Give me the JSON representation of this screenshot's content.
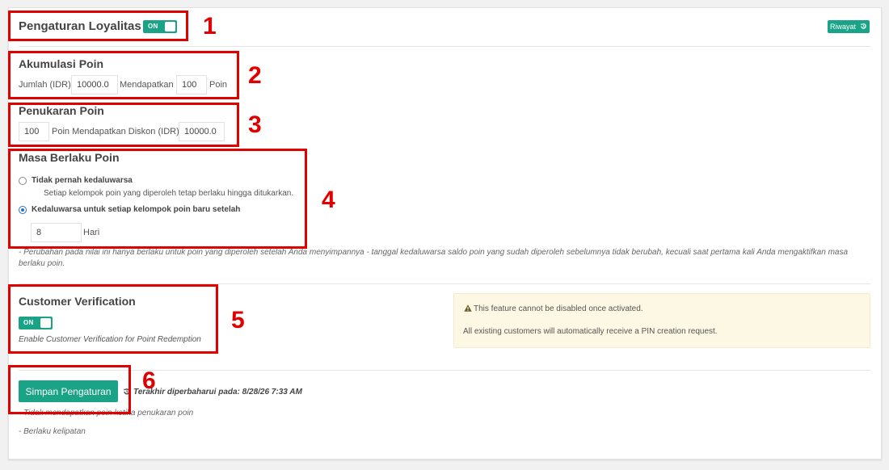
{
  "header": {
    "title": "Pengaturan Loyalitas",
    "toggle_label": "ON",
    "history_button": "Riwayat"
  },
  "accumulation": {
    "title": "Akumulasi Poin",
    "amount_label": "Jumlah (IDR)",
    "amount_value": "10000.0",
    "earn_label": "Mendapatkan",
    "points_value": "100",
    "points_label": "Poin"
  },
  "redemption": {
    "title": "Penukaran Poin",
    "points_value": "100",
    "discount_label": "Poin Mendapatkan Diskon (IDR)",
    "discount_value": "10000.0"
  },
  "validity": {
    "title": "Masa Berlaku Poin",
    "option1_label": "Tidak pernah kedaluwarsa",
    "option1_desc": "Setiap kelompok poin yang diperoleh tetap berlaku hingga ditukarkan.",
    "option2_label": "Kedaluwarsa untuk setiap kelompok poin baru setelah",
    "days_value": "8",
    "days_label": "Hari",
    "note_line1": "- Perubahan pada nilai ini hanya berlaku untuk poin yang diperoleh setelah Anda menyimpannya - tanggal kedaluwarsa saldo poin yang sudah diperoleh sebelumnya tidak berubah, kecuali saat pertama kali Anda mengaktifkan masa",
    "note_line2": "berlaku poin."
  },
  "verification": {
    "title": "Customer Verification",
    "toggle_label": "ON",
    "desc": "Enable Customer Verification for Point Redemption",
    "warning_line1": "This feature cannot be disabled once activated.",
    "warning_line2": "All existing customers will automatically receive a PIN creation request."
  },
  "footer": {
    "save_button": "Simpan Pengaturan",
    "last_updated": "Terakhir diperbaharui pada: 8/28/26 7:33 AM",
    "note1": "- Tidak mendapatkan poin ketika penukaran poin",
    "note2": "- Berlaku kelipatan"
  },
  "annotations": [
    "1",
    "2",
    "3",
    "4",
    "5",
    "6"
  ],
  "colors": {
    "accent": "#1aa387",
    "annotation": "#e00000",
    "warning_bg": "#fcf8e3"
  }
}
